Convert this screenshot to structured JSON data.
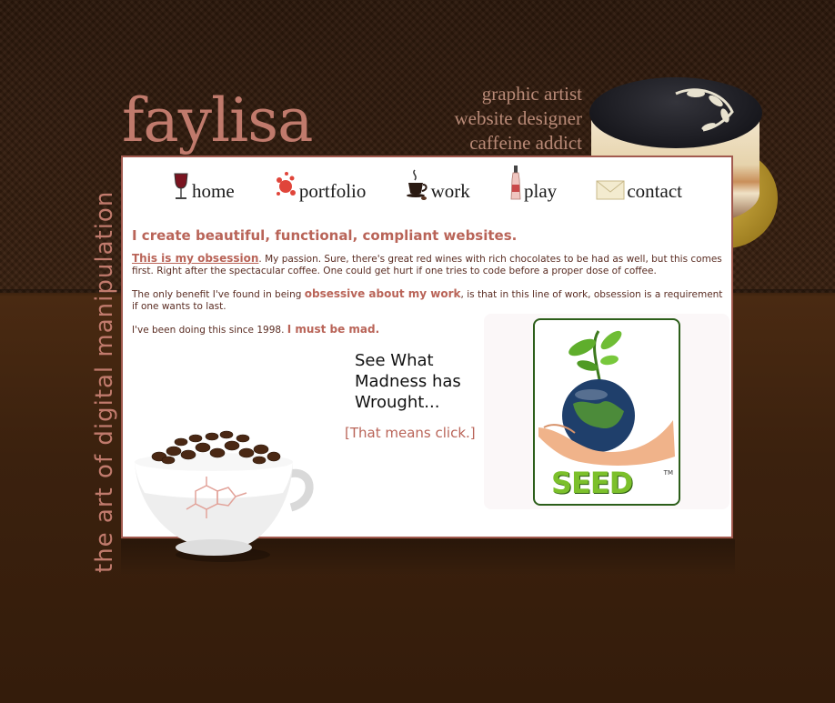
{
  "brand": {
    "logo_text": "faylisa",
    "taglines": [
      "graphic artist",
      "website designer",
      "caffeine addict"
    ],
    "side_text": "the art of digital manipulation"
  },
  "nav": {
    "items": [
      {
        "label": "home",
        "icon": "wine-glass-icon"
      },
      {
        "label": "portfolio",
        "icon": "paint-splat-icon"
      },
      {
        "label": "work",
        "icon": "coffee-cup-icon"
      },
      {
        "label": "play",
        "icon": "bottle-icon"
      },
      {
        "label": "contact",
        "icon": "envelope-icon"
      }
    ]
  },
  "content": {
    "heading": "I create beautiful, functional, compliant websites.",
    "p1_highlight": "This is my obsession",
    "p1_rest": ". My passion. Sure, there's great red wines with rich chocolates to be had as well, but this comes first. Right after the spectacular coffee. One could get hurt if one tries to code before a proper dose of coffee.",
    "p2_start": "The only benefit I've found in being ",
    "p2_highlight": "obsessive about my work",
    "p2_rest": ", is that in this line of work, obsession is a requirement if one wants to last.",
    "p3_start": "I've been doing this since 1998. ",
    "p3_highlight": "I must be mad."
  },
  "promo": {
    "line1": "See What",
    "line2": "Madness has",
    "line3": "Wrought...",
    "click_note": "[That means click.]",
    "seed_label": "SEED",
    "seed_tm": "TM"
  },
  "colors": {
    "accent": "#b96458",
    "brand": "#c07a6c",
    "background": "#3a2110"
  }
}
